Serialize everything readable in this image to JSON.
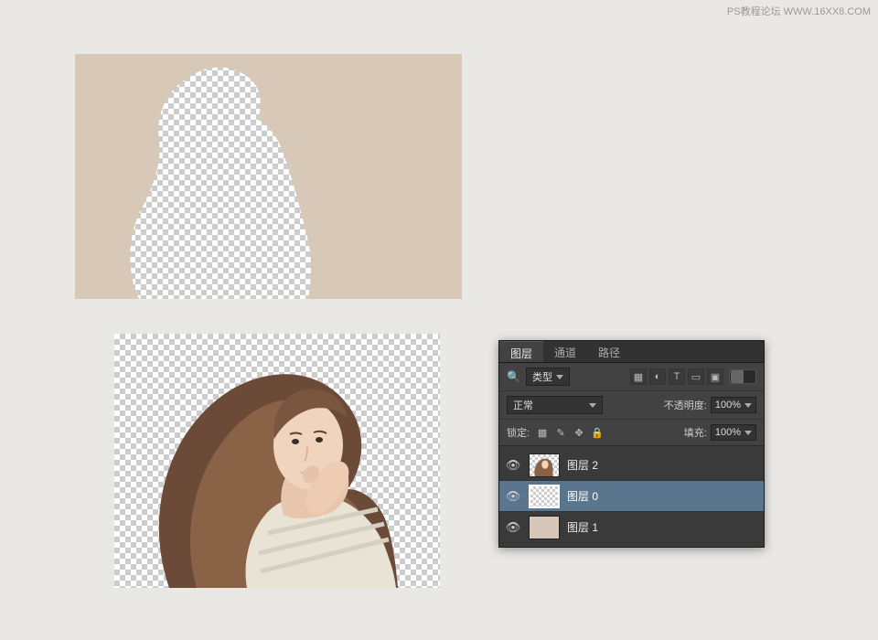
{
  "watermark": "PS教程论坛 WWW.16XX8.COM",
  "panel": {
    "tabs": {
      "layers": "图层",
      "channels": "通道",
      "paths": "路径"
    },
    "kind_filter": {
      "label": "类型"
    },
    "blend_mode": {
      "value": "正常"
    },
    "opacity": {
      "label": "不透明度:",
      "value": "100%"
    },
    "lock": {
      "label": "锁定:"
    },
    "fill": {
      "label": "填充:",
      "value": "100%"
    },
    "layers": [
      {
        "name": "图层 2",
        "selected": false,
        "visible": true
      },
      {
        "name": "图层 0",
        "selected": true,
        "visible": true
      },
      {
        "name": "图层 1",
        "selected": false,
        "visible": true
      }
    ]
  }
}
